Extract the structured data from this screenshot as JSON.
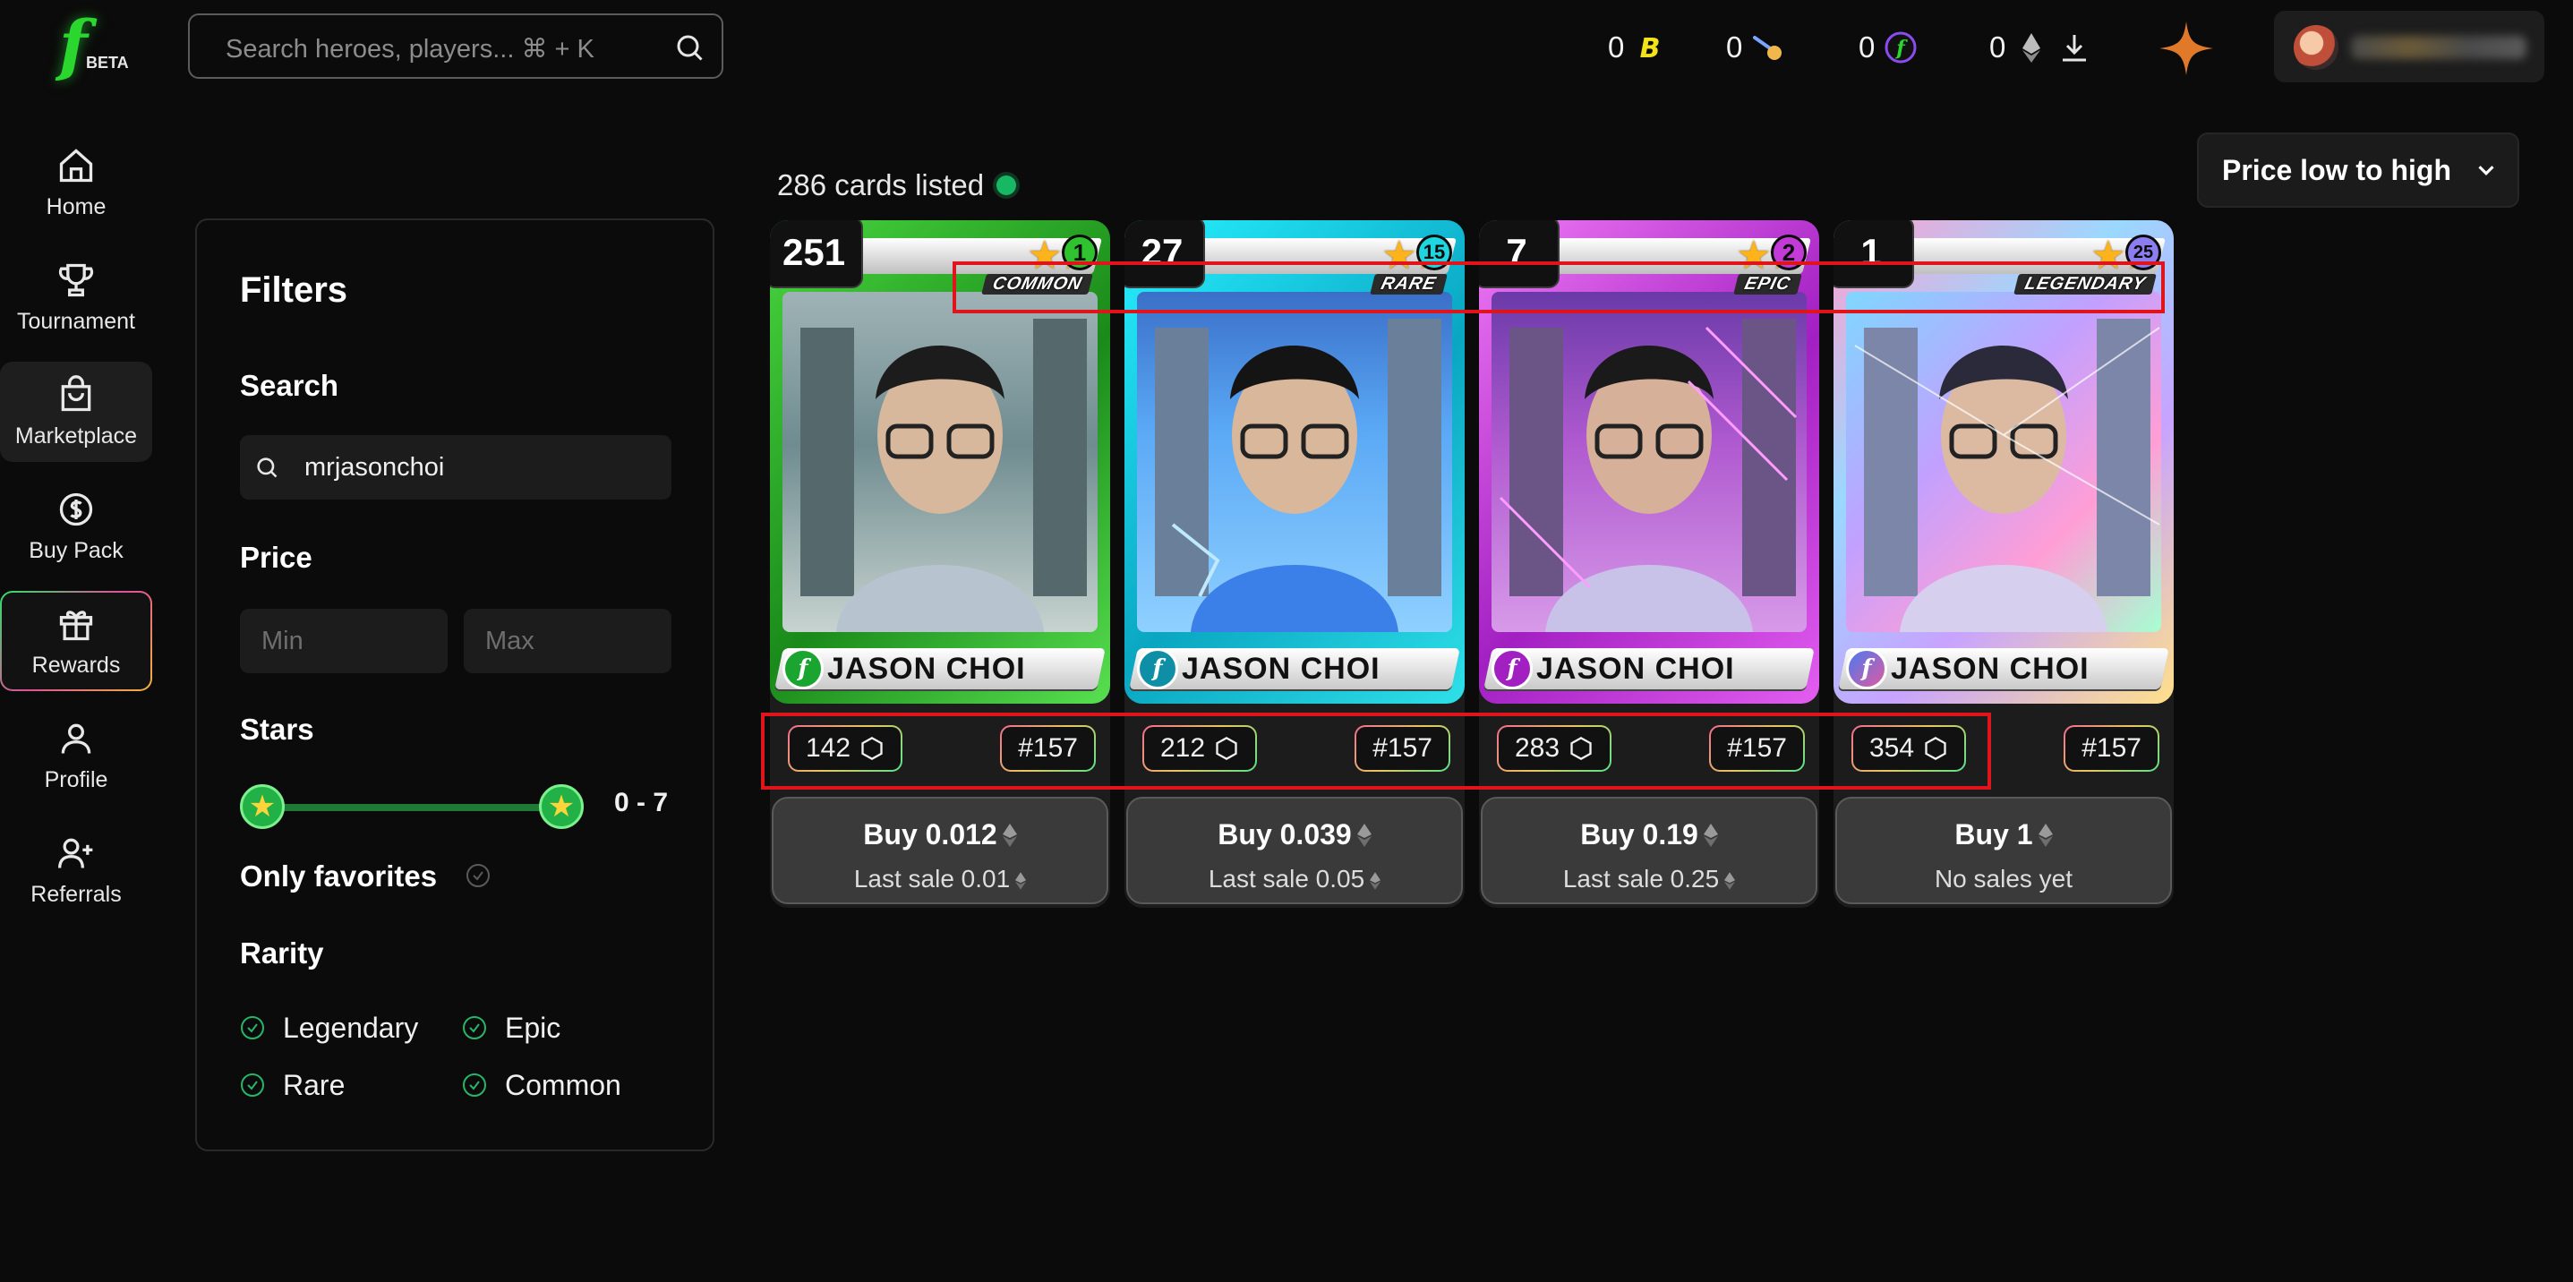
{
  "header": {
    "logo": "f",
    "logo_badge": "BETA",
    "search_placeholder": "Search heroes, players... ⌘ + K",
    "balances": [
      {
        "amount": "0",
        "icon": "bold-b-coin-icon",
        "color": "#f2e21a"
      },
      {
        "amount": "0",
        "icon": "comet-icon",
        "color": "#f0b84a"
      },
      {
        "amount": "0",
        "icon": "fantasy-token-icon",
        "color": "#2bd62f"
      },
      {
        "amount": "0",
        "icon": "ethereum-icon",
        "color": "#bdbdbd"
      }
    ]
  },
  "nav": {
    "items": [
      {
        "label": "Home",
        "icon": "home-icon"
      },
      {
        "label": "Tournament",
        "icon": "trophy-icon"
      },
      {
        "label": "Marketplace",
        "icon": "shopping-bag-icon"
      },
      {
        "label": "Buy Pack",
        "icon": "dollar-circle-icon"
      },
      {
        "label": "Rewards",
        "icon": "gift-icon"
      },
      {
        "label": "Profile",
        "icon": "user-icon"
      },
      {
        "label": "Referrals",
        "icon": "user-plus-icon"
      }
    ],
    "active": "Marketplace"
  },
  "filters": {
    "title": "Filters",
    "search_heading": "Search",
    "search_value": "mrjasonchoi",
    "price_heading": "Price",
    "min_placeholder": "Min",
    "max_placeholder": "Max",
    "stars_heading": "Stars",
    "stars_range": "0 - 7",
    "favorites_label": "Only favorites",
    "rarity_heading": "Rarity",
    "rarities": [
      "Legendary",
      "Epic",
      "Rare",
      "Common"
    ]
  },
  "market": {
    "listed_count": "286 cards listed",
    "sort_label": "Price low to high",
    "cards": [
      {
        "count": "251",
        "level": "1",
        "rarity": "COMMON",
        "name": "JASON CHOI",
        "serial": "142",
        "number": "#157",
        "buy": "Buy 0.012",
        "last": "Last sale 0.01",
        "accent": "#2fc42f"
      },
      {
        "count": "27",
        "level": "15",
        "rarity": "RARE",
        "name": "JASON CHOI",
        "serial": "212",
        "number": "#157",
        "buy": "Buy 0.039",
        "last": "Last sale 0.05",
        "accent": "#1ed6e0"
      },
      {
        "count": "7",
        "level": "2",
        "rarity": "EPIC",
        "name": "JASON CHOI",
        "serial": "283",
        "number": "#157",
        "buy": "Buy 0.19",
        "last": "Last sale 0.25",
        "accent": "#c23bd6"
      },
      {
        "count": "1",
        "level": "25",
        "rarity": "LEGENDARY",
        "name": "JASON CHOI",
        "serial": "354",
        "number": "#157",
        "buy": "Buy 1",
        "last": "No sales yet",
        "accent": "#8c7df0"
      }
    ]
  }
}
